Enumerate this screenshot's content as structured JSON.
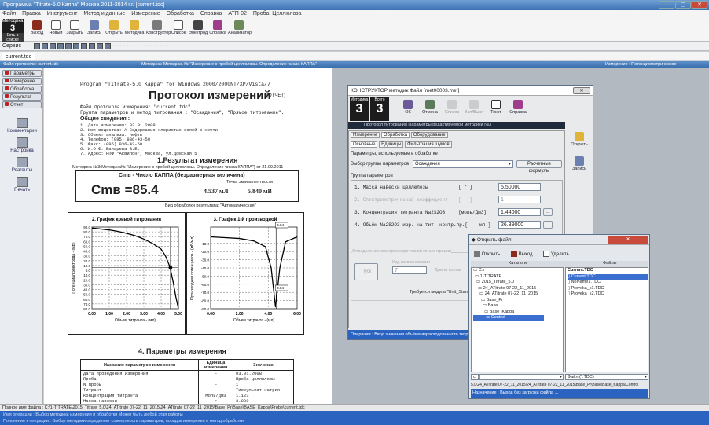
{
  "window": {
    "title": "Программа \"Titrate-5.0 Каппа\" Москва 2011-2014 г.г. [current.tdc]",
    "min": "–",
    "max": "▢",
    "close": "✕"
  },
  "menu": [
    "Файл",
    "Правка",
    "Инструмент",
    "Метод и данные",
    "Измерение",
    "Обработка",
    "Справка",
    "АТП-02",
    "Проба: Целлюлоза"
  ],
  "metodika": {
    "label": "Методика",
    "number": "3",
    "sub": "Есть в списке"
  },
  "toolbar": [
    "Выход",
    "Новый",
    "Закрыть",
    "Запись",
    "Открыть",
    "Методика",
    "Конструктор",
    "Список",
    "Электрод",
    "Справка",
    "Анализатор"
  ],
  "toolbar2": {
    "label": "Сервис",
    "text": "· · · · · · · · · · · · · · · · ·"
  },
  "doc_tab": "current.tdc",
  "inner": {
    "title": "Файл протокола: current.tdc",
    "method": "Методика: Методика № \"Измерение с пробой целлюлозы. Определение числа КАППА\"",
    "right": "Измерение : Потенциометрическое"
  },
  "left": {
    "buttons": [
      "Параметры",
      "Измерение",
      "Обработка",
      "Результат",
      "Отчет"
    ],
    "icons": [
      "Комментарии",
      "Настройка",
      "Реагенты",
      "Печать"
    ]
  },
  "doc": {
    "program": "Program \"Titrate-5.0 Kappa\" for Windows 2000/2000NT/XP/Vista/7",
    "title": "Протокол измерений",
    "title_suffix": "(ОТЧЕТ)",
    "file_line": "Файл протокола измерения: \"current.tdc\".",
    "group_line": "Группа параметров и метод титрования : \"Осаждения\", \"Прямое титрование\".",
    "general": "Общие сведения :",
    "info": [
      "1. Дата измерения: 03.01.2008",
      "2.    Имя вещества: А-Содержание хлористых солей в нефти",
      "3. Объект анализа: нефть",
      "4.       Телефон: (095) 936-43-50",
      "5.          Факс: (095) 936-43-50",
      "6.                И.О.Ф: Бачарева В.Е.",
      "7.              Адрес: НПФ \"Аквилон\", Москва, ул.Домская 5"
    ],
    "result_title": "1.Результат измерения",
    "result_method": "Методика №3(Методика№ \"Измерение с пробой целлюлозы. Определение числа КАППА\") от 21.09.2011",
    "cmb_head": "Cmв - Число КАППА (безразмерная величина)",
    "cmb_value": "Cmв =85.4",
    "eq_head": "Точка эквивалентности",
    "eq_ml": "4.537 мЛ",
    "eq_mv": "5.840 мВ",
    "proc": "Вид обработки результата: \"Автоматическая\"",
    "params_title": "4. Параметры измерения",
    "tbl_head": [
      "Название параметров измерения",
      "Единица измерения",
      "Значение"
    ],
    "tbl_rows": [
      [
        "Дата проведения измерения",
        "–",
        "03.01.2008"
      ],
      [
        "Проба",
        "–",
        "Проба целлюлозы"
      ],
      [
        "N пробы",
        "–",
        "1"
      ],
      [
        "Титрант",
        "–",
        "Тиосульфат натрия"
      ],
      [
        "Концентрация титранта",
        "Моль/дм3",
        "1.123"
      ],
      [
        "Масса навески",
        "г",
        "3.000"
      ]
    ]
  },
  "chart_data": [
    {
      "type": "line",
      "title": "2. График кривой титрования",
      "xlabel": "Объем титранта - (мл)",
      "ylabel": "Потенциал электрода - (мВ)",
      "ylim": [
        -80,
        90
      ],
      "xlim": [
        0,
        5
      ],
      "x_ticks": [
        "0.00",
        "1.00",
        "2.00",
        "3.00",
        "4.00",
        "5.00"
      ],
      "y_ticks": [
        "90.0",
        "80.0",
        "70.0",
        "60.0",
        "50.0",
        "40.0",
        "30.0",
        "20.0",
        "10.0",
        "0.0",
        "-10.0",
        "-20.0",
        "-30.0",
        "-40.0",
        "-50.0",
        "-60.0",
        "-70.0",
        "-80.0"
      ],
      "x": [
        0,
        0.5,
        1,
        1.5,
        2,
        2.5,
        3,
        3.5,
        4,
        4.25,
        4.5,
        4.55,
        4.7,
        4.85,
        5
      ],
      "y": [
        88,
        86,
        84,
        81,
        77,
        72,
        65,
        56,
        44,
        30,
        8,
        0,
        -25,
        -55,
        -80
      ],
      "marker": {
        "x": 4.54,
        "y": 5.8
      }
    },
    {
      "type": "line",
      "title": "3. График 1-й производной",
      "xlabel": "Объем титранта - (мл)",
      "ylabel": "Производная потенциала - (мВ/мл)",
      "ylim": [
        -90,
        10
      ],
      "xlim": [
        0,
        6
      ],
      "x_ticks": [
        "0.00",
        "2.00",
        "4.00",
        "6.00"
      ],
      "y_ticks": [
        "-10.0",
        "-20.0",
        "-30.0",
        "-40.0",
        "-50.0",
        "-60.0",
        "-70.0",
        "-80.0",
        "-90.0"
      ],
      "x": [
        0,
        1,
        2,
        3,
        3.8,
        4.2,
        4.5,
        4.8,
        5.2,
        6
      ],
      "y": [
        -2,
        -3,
        -4,
        -7,
        -14,
        -40,
        -88,
        -40,
        -8,
        -2
      ],
      "labels": [
        "4.54",
        "4.54"
      ]
    }
  ],
  "konst": {
    "title": "КОНСТРУКТОР методик   Файл [met00003.met]",
    "close": "✕",
    "metodika": "Методика",
    "metodika_n": "3",
    "vsego": "Всего",
    "vsego_n": "3",
    "tools": [
      "ОК",
      "Отмена",
      "Список",
      "Вкл/Выкл",
      "Текст",
      "Справка"
    ],
    "tabstrip": "Протокол титрования    Параметры редактируемой методики №3",
    "tabs1": [
      "Измерение",
      "Обработка",
      "Оборудование"
    ],
    "tabs2": [
      "Основные",
      "Единицы",
      "Фильтрация шумов"
    ],
    "param_caption": "Параметры, используемые в обработке",
    "group_label": "Выбор группы параметров",
    "group_value": "Осаждения",
    "formula_btn": "Расчетные формулы",
    "group_params": "Группа параметров",
    "rows": [
      {
        "label": "1. Масса навески целлюлозы",
        "unit": "[  г  ]",
        "value": "5.50000"
      },
      {
        "label": "2. Спектрометрический коэффициент",
        "unit": "[  –  ]",
        "value": "1"
      },
      {
        "label": "3. Концентрация титранта Na2S2O3",
        "unit": "[моль/Дм3]",
        "value": "1.44000"
      },
      {
        "label": "4. Объём Na2S2O3 изр. на тит. контр.пр.[",
        "unit": "мл  ]",
        "value": "26.39000"
      }
    ],
    "lower_caption": "Определение спектрометрической концентрации",
    "lower_left": "Пуск",
    "lower_mid": "Код наименования",
    "lower_val": "7",
    "lower_right": "Длина волны",
    "lower_req": "Требуется модуль \"Unit_Standart\" (опция)",
    "right_tools": [
      "Открыть",
      "Запись"
    ],
    "status": "Операция : Ввод значения объёма израсходованного титранта"
  },
  "fdlg": {
    "title": "Открыть файл",
    "tools": [
      "Открыть",
      "Выход",
      "Удалить"
    ],
    "col1": "Каталоги",
    "col2": "Файлы",
    "dirs": [
      "C:\\",
      "1-TITRATE",
      "2015_Titrate_5.0",
      "24_ATitrate 07-22_11_2015",
      "24_ATitrate 07-22_11_2015",
      "Base_Pr",
      "Base",
      "Base_Kappa",
      "Control"
    ],
    "files_head": "Current.TDC",
    "files": [
      "Current.TDC",
      "NoName1.TDC",
      "Proveka_k1.TDC",
      "Proveka_k2.TDC"
    ],
    "drive": "c: []",
    "filter": "Файл (*.TDC)",
    "path": "5.0\\24_ATitrate 07-22_11_2015\\24_ATitrate 07-22_11_2015\\Base_Pr\\Base\\Base_Kappa\\Control",
    "status": "Назначение : Выход без загрузки файла ..."
  },
  "statusbar": "Полное имя файла : C:\\1-TITRATE\\2015_Titrate_5.0\\24_ATitrate 07-22_11_2015\\24_ATitrate 07-22_11_2015\\Base_Pr\\Base\\BASE_Kappa\\Probe\\current.tdc",
  "bottom": [
    "Имя операции : Выбор методики измерения и обработки      Может быть любой этап работы",
    "Пояснение к операции : Выбор методики определяет совокупность параметров, порядок измерения и метод обработки"
  ]
}
